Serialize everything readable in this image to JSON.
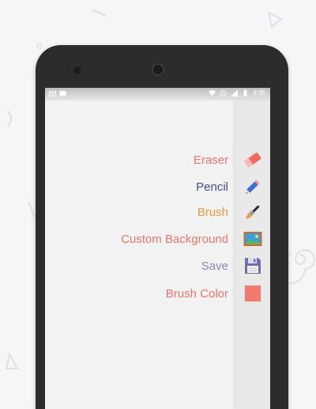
{
  "status_bar": {
    "time": "9:35"
  },
  "menu": [
    {
      "label": "Eraser",
      "icon": "eraser-icon",
      "color": "#e8756a"
    },
    {
      "label": "Pencil",
      "icon": "pencil-icon",
      "color": "#3e4f8f"
    },
    {
      "label": "Brush",
      "icon": "brush-icon",
      "color": "#e59a3b"
    },
    {
      "label": "Custom Background",
      "icon": "image-icon",
      "color": "#e8756a"
    },
    {
      "label": "Save",
      "icon": "floppy-disk-icon",
      "color": "#8b86b5"
    },
    {
      "label": "Brush Color",
      "icon": "color-swatch-icon",
      "color": "#e8756a"
    }
  ],
  "colors": {
    "brush_color_swatch": "#ef7a70",
    "background": "#f6f6f8",
    "phone_body": "#2c2c2c"
  }
}
